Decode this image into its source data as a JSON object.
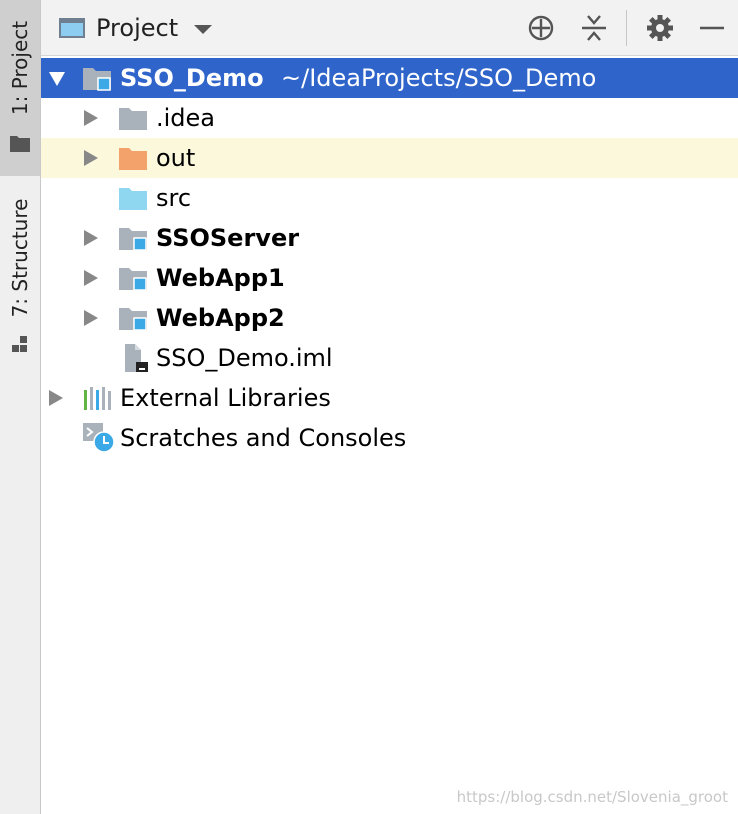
{
  "side_tabs": {
    "project": {
      "label": "1: Project"
    },
    "structure": {
      "label": "7: Structure"
    }
  },
  "toolbar": {
    "view_title": "Project",
    "buttons": [
      "locate-icon",
      "collapse-all-icon",
      "gear-icon",
      "minimize-icon"
    ]
  },
  "tree": {
    "root": {
      "name": "SSO_Demo",
      "path": "~/IdeaProjects/SSO_Demo"
    },
    "children": [
      {
        "name": ".idea",
        "type": "folder"
      },
      {
        "name": "out",
        "type": "excluded-folder"
      },
      {
        "name": "src",
        "type": "source-folder"
      },
      {
        "name": "SSOServer",
        "type": "module"
      },
      {
        "name": "WebApp1",
        "type": "module"
      },
      {
        "name": "WebApp2",
        "type": "module"
      },
      {
        "name": "SSO_Demo.iml",
        "type": "iml-file"
      }
    ],
    "external_libraries": "External Libraries",
    "scratches": "Scratches and Consoles"
  },
  "watermark": "https://blog.csdn.net/Slovenia_groot",
  "colors": {
    "selection": "#2f65ca",
    "highlight_row": "#fcf8dc",
    "excluded_folder": "#f4a26b",
    "source_folder": "#8fd6f0",
    "folder": "#a9b2ba",
    "module_badge": "#3ba9e6"
  }
}
